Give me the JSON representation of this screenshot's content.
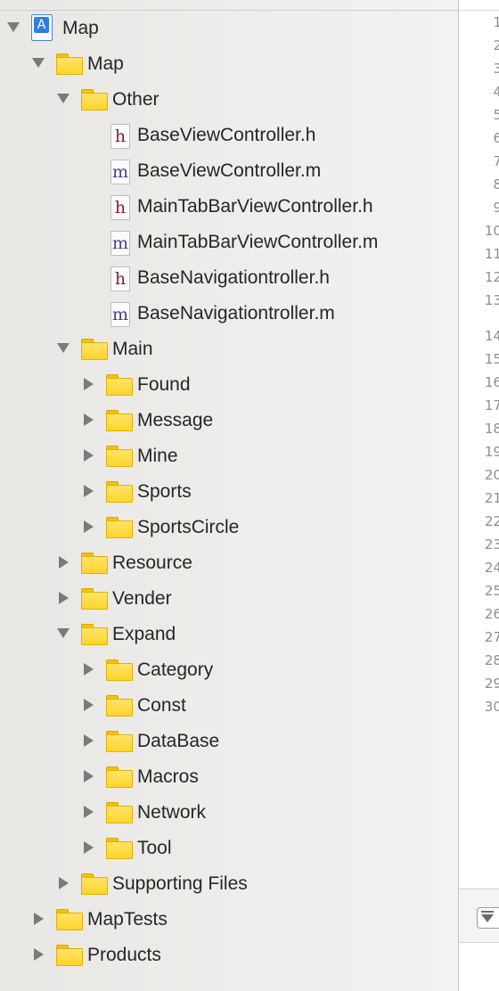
{
  "navigator": {
    "rows": [
      {
        "label": "Map",
        "kind": "project",
        "disclosure": "open",
        "depth": 0
      },
      {
        "label": "Map",
        "kind": "folder",
        "disclosure": "open",
        "depth": 1
      },
      {
        "label": "Other",
        "kind": "folder",
        "disclosure": "open",
        "depth": 2
      },
      {
        "label": "BaseViewController.h",
        "kind": "file-h",
        "disclosure": "none",
        "depth": 3
      },
      {
        "label": "BaseViewController.m",
        "kind": "file-m",
        "disclosure": "none",
        "depth": 3
      },
      {
        "label": "MainTabBarViewController.h",
        "kind": "file-h",
        "disclosure": "none",
        "depth": 3
      },
      {
        "label": "MainTabBarViewController.m",
        "kind": "file-m",
        "disclosure": "none",
        "depth": 3
      },
      {
        "label": "BaseNavigationtroller.h",
        "kind": "file-h",
        "disclosure": "none",
        "depth": 3
      },
      {
        "label": "BaseNavigationtroller.m",
        "kind": "file-m",
        "disclosure": "none",
        "depth": 3
      },
      {
        "label": "Main",
        "kind": "folder",
        "disclosure": "open",
        "depth": 2
      },
      {
        "label": "Found",
        "kind": "folder",
        "disclosure": "closed",
        "depth": 3
      },
      {
        "label": "Message",
        "kind": "folder",
        "disclosure": "closed",
        "depth": 3
      },
      {
        "label": "Mine",
        "kind": "folder",
        "disclosure": "closed",
        "depth": 3
      },
      {
        "label": "Sports",
        "kind": "folder",
        "disclosure": "closed",
        "depth": 3
      },
      {
        "label": "SportsCircle",
        "kind": "folder",
        "disclosure": "closed",
        "depth": 3
      },
      {
        "label": "Resource",
        "kind": "folder",
        "disclosure": "closed",
        "depth": 2
      },
      {
        "label": "Vender",
        "kind": "folder",
        "disclosure": "closed",
        "depth": 2
      },
      {
        "label": "Expand",
        "kind": "folder",
        "disclosure": "open",
        "depth": 2
      },
      {
        "label": "Category",
        "kind": "folder",
        "disclosure": "closed",
        "depth": 3
      },
      {
        "label": "Const",
        "kind": "folder",
        "disclosure": "closed",
        "depth": 3
      },
      {
        "label": "DataBase",
        "kind": "folder",
        "disclosure": "closed",
        "depth": 3
      },
      {
        "label": "Macros",
        "kind": "folder",
        "disclosure": "closed",
        "depth": 3
      },
      {
        "label": "Network",
        "kind": "folder",
        "disclosure": "closed",
        "depth": 3
      },
      {
        "label": "Tool",
        "kind": "folder",
        "disclosure": "closed",
        "depth": 3
      },
      {
        "label": "Supporting Files",
        "kind": "folder",
        "disclosure": "closed",
        "depth": 2
      },
      {
        "label": "MapTests",
        "kind": "folder",
        "disclosure": "closed",
        "depth": 1
      },
      {
        "label": "Products",
        "kind": "folder",
        "disclosure": "closed",
        "depth": 1
      }
    ]
  },
  "editor": {
    "line_numbers": [
      "1",
      "2",
      "3",
      "4",
      "5",
      "6",
      "7",
      "8",
      "9",
      "10",
      "11",
      "12",
      "13",
      "14",
      "15",
      "16",
      "17",
      "18",
      "19",
      "20",
      "21",
      "22",
      "23",
      "24",
      "25",
      "26",
      "27",
      "28",
      "29",
      "30"
    ]
  },
  "icons": {
    "project": "xcode-project-icon",
    "folder": "folder-icon",
    "header_file": "h-file-icon",
    "impl_file": "m-file-icon",
    "disclosure_open": "disclosure-open-icon",
    "disclosure_closed": "disclosure-closed-icon",
    "filter": "filter-icon"
  },
  "colors": {
    "folder": "#ffd52a",
    "h_file": "#8a1f2d",
    "m_file": "#4b3f8f",
    "project": "#2f7fe0"
  }
}
